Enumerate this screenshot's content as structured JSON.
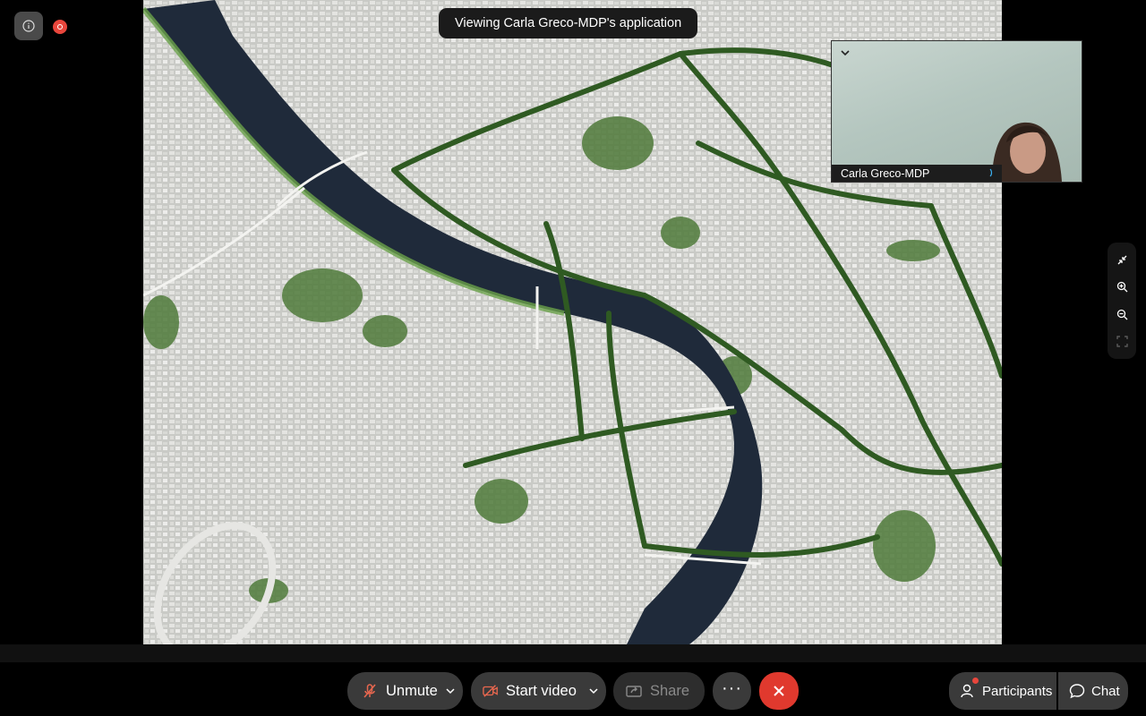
{
  "meeting": {
    "viewing_banner": "Viewing Carla Greco-MDP's application"
  },
  "self_view": {
    "participant_name": "Carla Greco-MDP"
  },
  "controls": {
    "unmute_label": "Unmute",
    "start_video_label": "Start video",
    "share_label": "Share",
    "more_label": "···",
    "participants_label": "Participants",
    "chat_label": "Chat"
  },
  "colors": {
    "end_call": "#e0392e",
    "recording": "#e8463c",
    "control_bg": "#3a3a3a"
  }
}
